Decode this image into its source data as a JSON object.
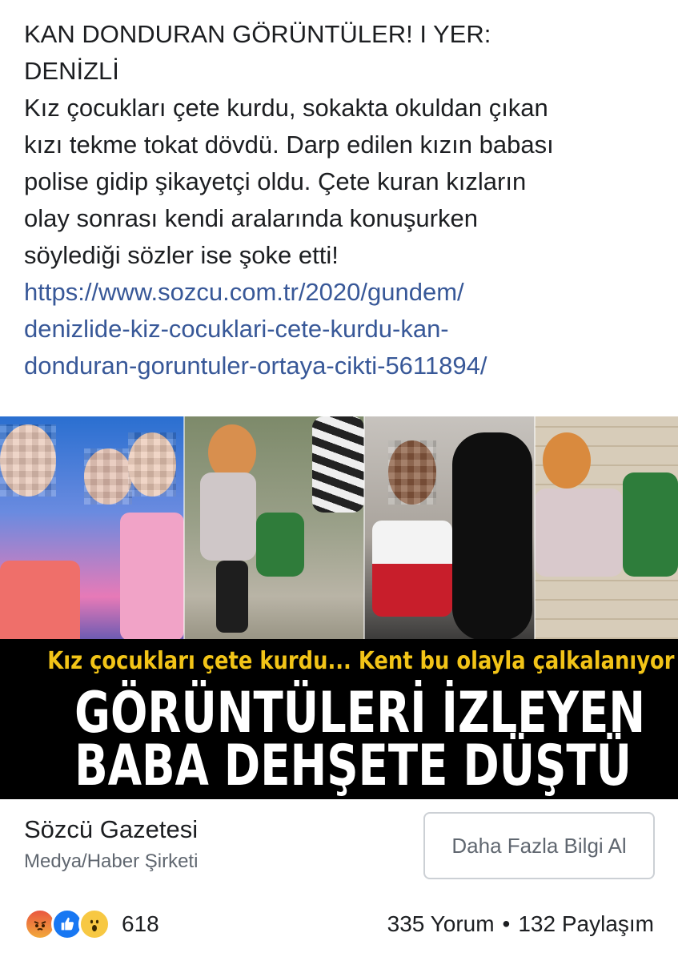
{
  "post": {
    "lines": [
      "KAN DONDURAN GÖRÜNTÜLER! I YER:",
      "DENİZLİ",
      "Kız çocukları çete kurdu, sokakta okuldan çıkan",
      "kızı tekme tokat dövdü. Darp edilen kızın babası",
      "polise gidip şikayetçi oldu. Çete kuran kızların",
      "olay sonrası kendi aralarında konuşurken",
      "söylediği sözler ise şoke etti!"
    ],
    "link_lines": [
      "https://www.sozcu.com.tr/2020/gundem/",
      "denizlide-kiz-cocuklari-cete-kurdu-kan-",
      "donduran-goruntuler-ortaya-cikti-5611894/"
    ],
    "link_color": "#385898"
  },
  "image": {
    "banner_sub": "Kız çocukları çete kurdu... Kent bu olayla çalkalanıyor",
    "banner_main_1": "GÖRÜNTÜLERİ İZLEYEN",
    "banner_main_2": "BABA DEHŞETE DÜŞTÜ",
    "sub_color": "#f2c417"
  },
  "card": {
    "page_name": "Sözcü Gazetesi",
    "category": "Medya/Haber Şirketi",
    "cta_label": "Daha Fazla Bilgi Al"
  },
  "reactions": {
    "icons": [
      "angry-icon",
      "like-icon",
      "wow-icon"
    ],
    "count": "618",
    "comments": "335 Yorum",
    "separator": "•",
    "shares": "132 Paylaşım"
  }
}
